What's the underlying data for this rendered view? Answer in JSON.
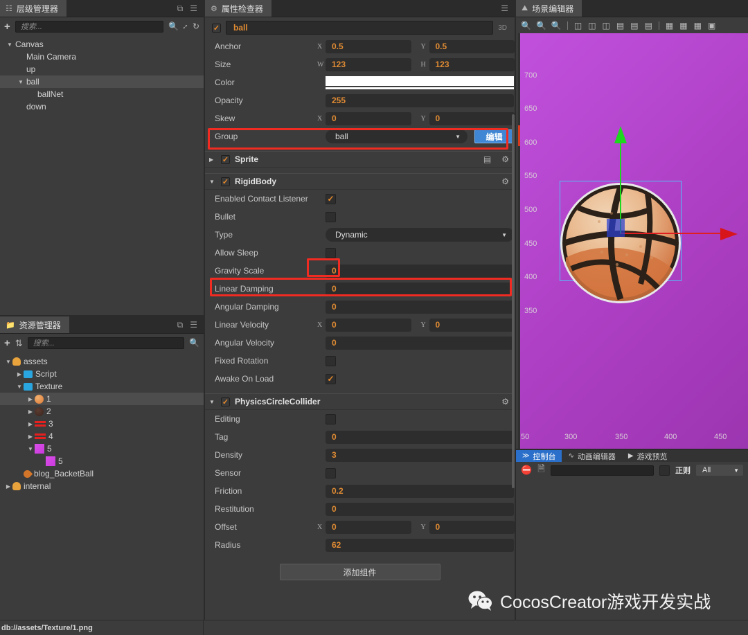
{
  "hierarchy_panel": {
    "tab_title": "层级管理器",
    "tab_icon": "hierarchy-icon",
    "search_placeholder": "搜索...",
    "add_icon": "plus-icon",
    "search_icon": "search-icon",
    "expand_icon": "expand-icon",
    "refresh_icon": "refresh-icon",
    "popout_icon": "popout-icon",
    "menu_icon": "hamburger-icon",
    "nodes": [
      {
        "label": "Canvas",
        "depth": 0,
        "arrow": "down",
        "selected": false
      },
      {
        "label": "Main Camera",
        "depth": 1,
        "arrow": "none",
        "selected": false
      },
      {
        "label": "up",
        "depth": 1,
        "arrow": "none",
        "selected": false
      },
      {
        "label": "ball",
        "depth": 1,
        "arrow": "down",
        "selected": true
      },
      {
        "label": "ballNet",
        "depth": 2,
        "arrow": "none",
        "selected": false
      },
      {
        "label": "down",
        "depth": 1,
        "arrow": "none",
        "selected": false
      }
    ]
  },
  "assets_panel": {
    "tab_title": "资源管理器",
    "tab_icon": "folder-icon",
    "search_placeholder": "搜索...",
    "add_icon": "plus-icon",
    "sort_icon": "sort-icon",
    "search_icon": "search-icon",
    "popout_icon": "popout-icon",
    "menu_icon": "hamburger-icon",
    "nodes": [
      {
        "label": "assets",
        "depth": 0,
        "arrow": "down",
        "icon": "db-icon",
        "color": "#e8a33d",
        "selected": false
      },
      {
        "label": "Script",
        "depth": 1,
        "arrow": "right",
        "icon": "folder-icon",
        "color": "#29a6e0",
        "selected": false
      },
      {
        "label": "Texture",
        "depth": 1,
        "arrow": "down",
        "icon": "folder-icon",
        "color": "#29a6e0",
        "selected": false
      },
      {
        "label": "1",
        "depth": 2,
        "arrow": "right",
        "icon": "ball-texture",
        "color": "#e07a35",
        "selected": true
      },
      {
        "label": "2",
        "depth": 2,
        "arrow": "right",
        "icon": "dark-texture",
        "color": "#4a2f28",
        "selected": false
      },
      {
        "label": "3",
        "depth": 2,
        "arrow": "right",
        "icon": "red-texture",
        "color": "#e81f1f",
        "selected": false
      },
      {
        "label": "4",
        "depth": 2,
        "arrow": "right",
        "icon": "red-texture",
        "color": "#e81f1f",
        "selected": false
      },
      {
        "label": "5",
        "depth": 2,
        "arrow": "down",
        "icon": "pink-texture",
        "color": "#cb39dd",
        "selected": false
      },
      {
        "label": "5",
        "depth": 3,
        "arrow": "none",
        "icon": "pink-texture",
        "color": "#cb39dd",
        "selected": false
      },
      {
        "label": "blog_BacketBall",
        "depth": 1,
        "arrow": "none",
        "icon": "fire-icon",
        "color": "#d4762a",
        "selected": false
      },
      {
        "label": "internal",
        "depth": 0,
        "arrow": "right",
        "icon": "db-icon",
        "color": "#e8a33d",
        "selected": false
      }
    ]
  },
  "inspector": {
    "tab_title": "属性检查器",
    "tab_icon": "gear-icon",
    "menu_icon": "hamburger-icon",
    "node_name": "ball",
    "node_enabled": true,
    "badge_3d": "3D",
    "node_props": [
      {
        "label": "Anchor",
        "type": "xy",
        "x": "0.5",
        "y": "0.5",
        "xlabel": "X",
        "ylabel": "Y"
      },
      {
        "label": "Size",
        "type": "xy",
        "x": "123",
        "y": "123",
        "xlabel": "W",
        "ylabel": "H"
      },
      {
        "label": "Color",
        "type": "color",
        "value": "#ffffff"
      },
      {
        "label": "Opacity",
        "type": "number",
        "value": "255"
      },
      {
        "label": "Skew",
        "type": "xy",
        "x": "0",
        "y": "0",
        "xlabel": "X",
        "ylabel": "Y"
      },
      {
        "label": "Group",
        "type": "select",
        "value": "ball",
        "button": "编辑"
      }
    ],
    "components": [
      {
        "name": "Sprite",
        "enabled": true,
        "expanded": false,
        "icons": [
          "help-icon",
          "gear-icon"
        ],
        "props": []
      },
      {
        "name": "RigidBody",
        "enabled": true,
        "expanded": true,
        "icons": [
          "gear-icon"
        ],
        "props": [
          {
            "label": "Enabled Contact Listener",
            "type": "checkbox",
            "value": true
          },
          {
            "label": "Bullet",
            "type": "checkbox",
            "value": false
          },
          {
            "label": "Type",
            "type": "select",
            "value": "Dynamic"
          },
          {
            "label": "Allow Sleep",
            "type": "checkbox",
            "value": false
          },
          {
            "label": "Gravity Scale",
            "type": "number",
            "value": "0"
          },
          {
            "label": "Linear Damping",
            "type": "number",
            "value": "0"
          },
          {
            "label": "Angular Damping",
            "type": "number",
            "value": "0"
          },
          {
            "label": "Linear Velocity",
            "type": "xy",
            "x": "0",
            "y": "0",
            "xlabel": "X",
            "ylabel": "Y"
          },
          {
            "label": "Angular Velocity",
            "type": "number",
            "value": "0"
          },
          {
            "label": "Fixed Rotation",
            "type": "checkbox",
            "value": false
          },
          {
            "label": "Awake On Load",
            "type": "checkbox",
            "value": true
          }
        ]
      },
      {
        "name": "PhysicsCircleCollider",
        "enabled": true,
        "expanded": true,
        "icons": [
          "gear-icon"
        ],
        "props": [
          {
            "label": "Editing",
            "type": "checkbox",
            "value": false
          },
          {
            "label": "Tag",
            "type": "number",
            "value": "0"
          },
          {
            "label": "Density",
            "type": "number",
            "value": "3"
          },
          {
            "label": "Sensor",
            "type": "checkbox",
            "value": false
          },
          {
            "label": "Friction",
            "type": "number",
            "value": "0.2"
          },
          {
            "label": "Restitution",
            "type": "number",
            "value": "0"
          },
          {
            "label": "Offset",
            "type": "xy",
            "x": "0",
            "y": "0",
            "xlabel": "X",
            "ylabel": "Y"
          },
          {
            "label": "Radius",
            "type": "number",
            "value": "62"
          }
        ]
      }
    ],
    "add_component_label": "添加组件"
  },
  "scene_panel": {
    "tab_title": "场景编辑器",
    "tab_icon": "scene-icon",
    "toolbar_icons": [
      "zoom-in-icon",
      "zoom-out-icon",
      "zoom-fit-icon",
      "align-left-icon",
      "align-center-h-icon",
      "align-right-icon",
      "align-top-icon",
      "align-middle-v-icon",
      "align-bottom-icon",
      "distribute-h-icon",
      "distribute-v-icon",
      "distribute-even-icon",
      "mirror-icon"
    ],
    "background_color": "#b845cf",
    "ruler_y_labels": [
      "700",
      "650",
      "600",
      "550",
      "500",
      "450",
      "400",
      "350"
    ],
    "ruler_x_labels": [
      "50",
      "300",
      "350",
      "400",
      "450"
    ],
    "gizmo": {
      "y_axis_color": "#1ed81e",
      "x_axis_color": "#e02020",
      "selection_color": "#4fc3f7"
    },
    "sprite_name": "basketball"
  },
  "console_panel": {
    "tabs": [
      {
        "label": "控制台",
        "icon": "console-icon",
        "active": true
      },
      {
        "label": "动画编辑器",
        "icon": "animation-icon",
        "active": false
      },
      {
        "label": "游戏预览",
        "icon": "camera-icon",
        "active": false
      }
    ],
    "clear_icon": "clear-icon",
    "file_icon": "file-icon",
    "filter_value": "",
    "regex_label": "正则",
    "regex_checked": false,
    "level_filter": "All"
  },
  "statusbar": {
    "path": "db://assets/Texture/1.png"
  },
  "watermark": {
    "icon": "wechat-icon",
    "text": "CocosCreator游戏开发实战"
  }
}
